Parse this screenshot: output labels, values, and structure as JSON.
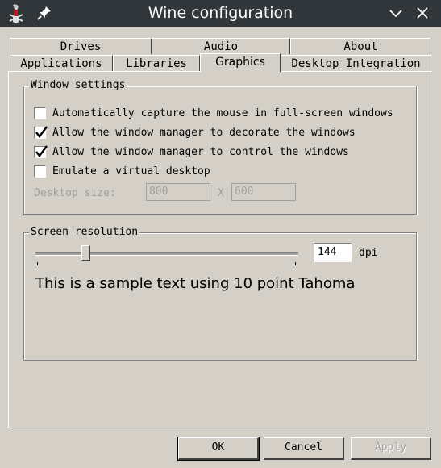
{
  "window": {
    "title": "Wine configuration"
  },
  "tabs_row1": [
    {
      "label": "Drives"
    },
    {
      "label": "Audio"
    },
    {
      "label": "About"
    }
  ],
  "tabs_row2": [
    {
      "label": "Applications"
    },
    {
      "label": "Libraries"
    },
    {
      "label": "Graphics",
      "active": true
    },
    {
      "label": "Desktop Integration"
    }
  ],
  "window_settings": {
    "title": "Window settings",
    "options": [
      {
        "label": "Automatically capture the mouse in full-screen windows",
        "checked": false
      },
      {
        "label": "Allow the window manager to decorate the windows",
        "checked": true
      },
      {
        "label": "Allow the window manager to control the windows",
        "checked": true
      },
      {
        "label": "Emulate a virtual desktop",
        "checked": false
      }
    ],
    "desktop_size_label": "Desktop size:",
    "width_value": "800",
    "separator": "X",
    "height_value": "600"
  },
  "screen_resolution": {
    "title": "Screen resolution",
    "dpi_value": "144",
    "dpi_unit": "dpi",
    "slider_fraction": 0.2,
    "sample_text": "This is a sample text using 10 point Tahoma"
  },
  "buttons": {
    "ok": "OK",
    "cancel": "Cancel",
    "apply": "Apply"
  }
}
